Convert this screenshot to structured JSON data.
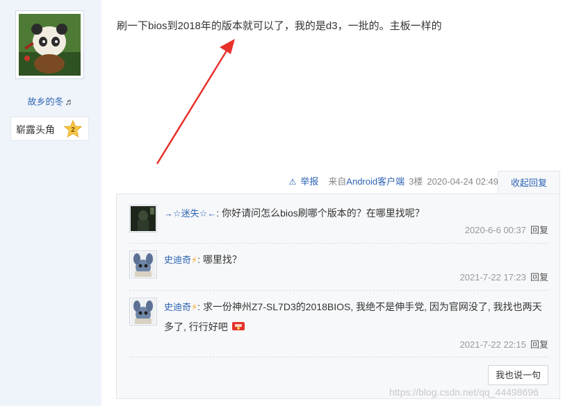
{
  "author": {
    "name": "故乡的冬",
    "name_suffix": "♬",
    "level_title": "崭露头角",
    "level_number": "2"
  },
  "post": {
    "content": "刷一下bios到2018年的版本就可以了，我的是d3，一批的。主板一样的",
    "report_label": "举报",
    "source_prefix": "来自",
    "source_client": "Android客户端",
    "floor": "3楼",
    "datetime": "2020-04-24 02:49",
    "collapse_label": "收起回复"
  },
  "replies": [
    {
      "user": "→☆迷失☆←",
      "separator": ":",
      "text": "你好请问怎么bios刷哪个版本的？在哪里找呢？",
      "time": "2020-6-6 00:37",
      "reply_label": "回复"
    },
    {
      "user": "史迪奇",
      "separator": ":",
      "text": "哪里找？",
      "time": "2021-7-22 17:23",
      "reply_label": "回复"
    },
    {
      "user": "史迪奇",
      "separator": ":",
      "text": "求一份神州Z7-SL7D3的2018BIOS, 我绝不是伸手党, 因为官网没了, 我找也两天多了, 行行好吧",
      "time": "2021-7-22 22:15",
      "reply_label": "回复"
    }
  ],
  "say_button": "我也说一句",
  "watermark": "https://blog.csdn.net/qq_44498696",
  "colors": {
    "link": "#2d64b3",
    "arrow": "#e8312b",
    "sidebar_bg": "#eff3fa"
  }
}
